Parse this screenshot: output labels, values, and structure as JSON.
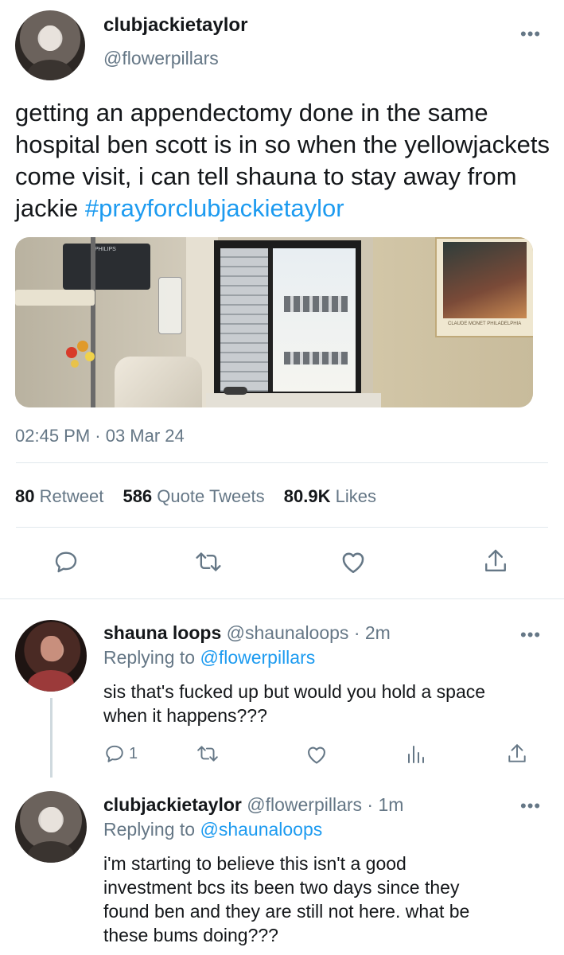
{
  "main_tweet": {
    "display_name": "clubjackietaylor",
    "handle": "@flowerpillars",
    "text": "getting an appendectomy done in the same hospital ben scott is in so when the yellowjackets come visit, i can tell shauna to stay away from jackie ",
    "hashtag": "#prayforclubjackietaylor",
    "timestamp": "02:45 PM · 03 Mar 24",
    "stats": {
      "retweets": "80",
      "retweets_label": "Retweet",
      "quotes": "586",
      "quotes_label": "Quote Tweets",
      "likes": "80.9K",
      "likes_label": "Likes"
    },
    "photo_text": {
      "monitor_brand": "PHILIPS",
      "poster_caption": "CLAUDE MONET  PHILADELPHIA"
    }
  },
  "reply1": {
    "display_name": "shauna loops",
    "handle": "@shaunaloops",
    "time": " · 2m",
    "replying_prefix": "Replying to ",
    "replying_to": "@flowerpillars",
    "text_line1": "sis that's fucked up but would you hold a space",
    "text_line2": "when it happens???",
    "reply_count": "1"
  },
  "reply2": {
    "display_name": "clubjackietaylor",
    "handle": "@flowerpillars",
    "time": " · 1m",
    "replying_prefix": "Replying to ",
    "replying_to": "@shaunaloops",
    "text_line1": "i'm starting to believe this isn't a good",
    "text_line2": "investment bcs its been two days since they",
    "text_line3": "found ben and they are still not here. what be",
    "text_line4": "these bums doing???"
  },
  "icons": {
    "more": "more-dots-icon",
    "reply": "reply-bubble-icon",
    "retweet": "retweet-icon",
    "like": "heart-icon",
    "share": "share-icon",
    "analytics": "analytics-bars-icon"
  },
  "colors": {
    "link": "#1d9bf0",
    "muted": "#657786",
    "divider": "#e1e8ed",
    "text": "#14171a"
  }
}
